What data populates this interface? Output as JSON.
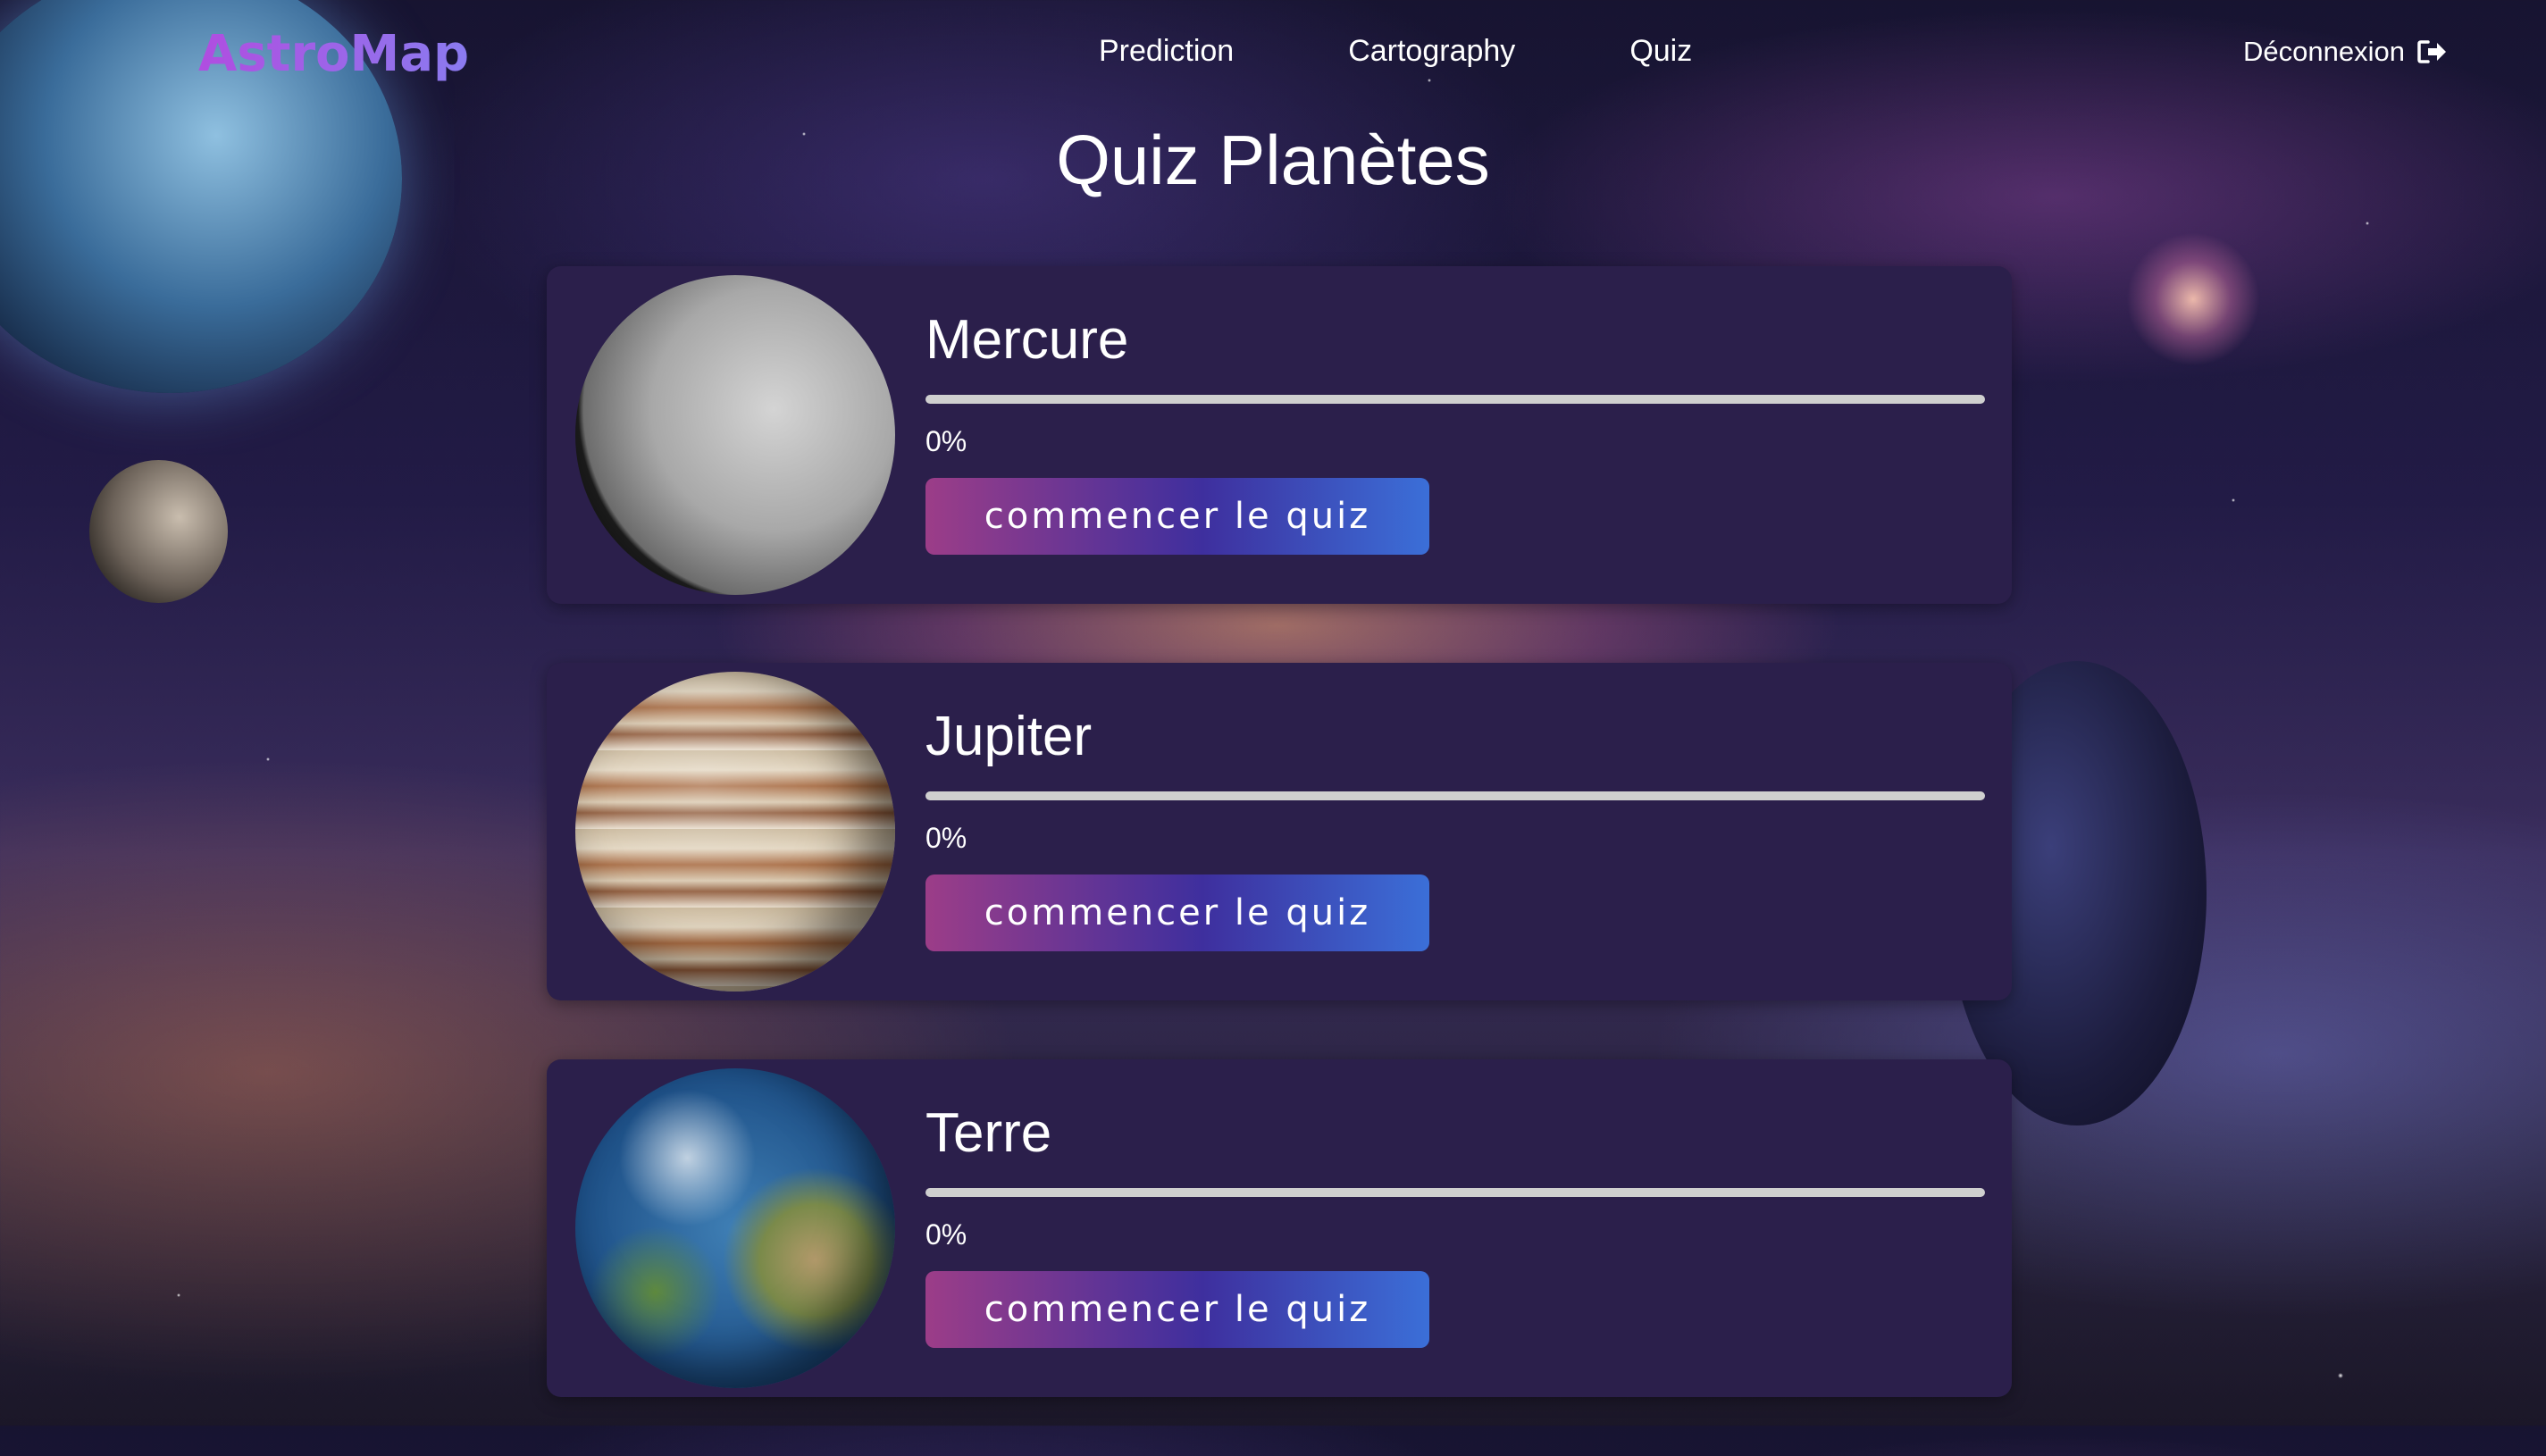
{
  "nav": {
    "logo": "AstroMap",
    "links": [
      "Prediction",
      "Cartography",
      "Quiz"
    ],
    "logout_label": "Déconnexion",
    "logout_icon": "logout-icon"
  },
  "page": {
    "title": "Quiz Planètes"
  },
  "quizzes": [
    {
      "name": "Mercure",
      "progress_text": "0%",
      "progress": 0,
      "button": "commencer le quiz",
      "image": "mercury-planet"
    },
    {
      "name": "Jupiter",
      "progress_text": "0%",
      "progress": 0,
      "button": "commencer le quiz",
      "image": "jupiter-planet"
    },
    {
      "name": "Terre",
      "progress_text": "0%",
      "progress": 0,
      "button": "commencer le quiz",
      "image": "earth-planet"
    }
  ],
  "colors": {
    "card_bg": "#2b1f4b",
    "button_gradient_start": "#9c3d88",
    "button_gradient_end": "#3b6fd8",
    "logo_gradient_start": "#b04de0"
  }
}
